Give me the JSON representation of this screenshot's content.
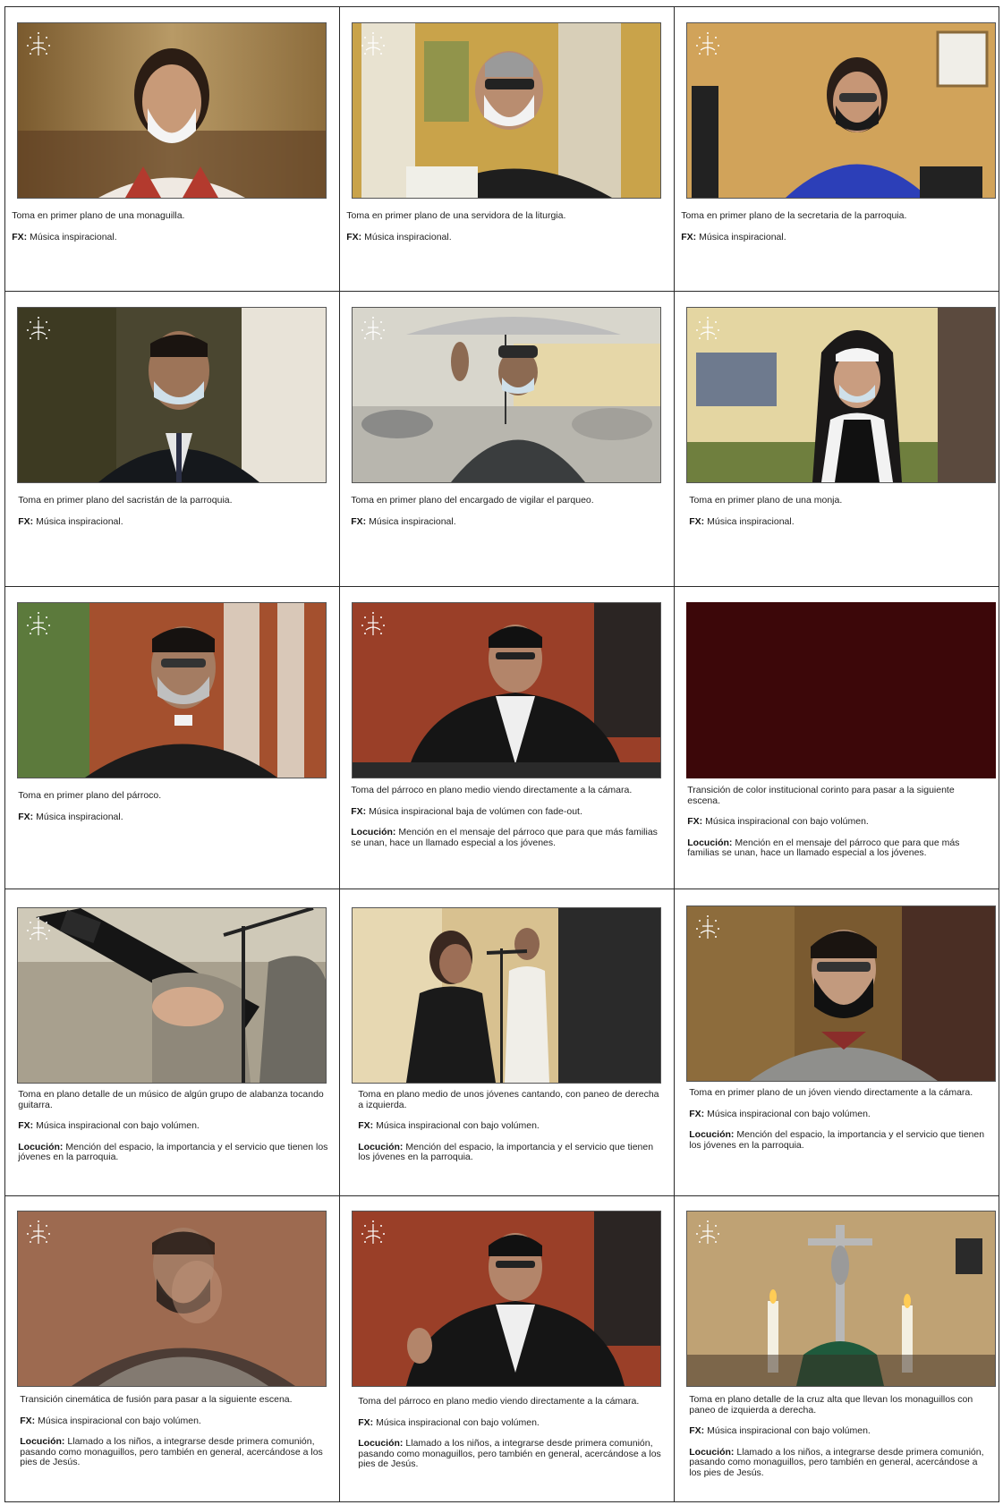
{
  "storyboard": {
    "fx_label": "FX:",
    "locucion_label": "Locución:",
    "panels": [
      {
        "description": "Toma en primer plano de una monaguilla.",
        "fx": "Música inspiracional.",
        "locucion": "",
        "scene": "altar-girl"
      },
      {
        "description": "Toma en primer plano de una servidora de la liturgia.",
        "fx": "Música inspiracional.",
        "locucion": "",
        "scene": "liturgy-server"
      },
      {
        "description": "Toma en primer plano de la secretaria de la parroquia.",
        "fx": "Música inspiracional.",
        "locucion": "",
        "scene": "secretary"
      },
      {
        "description": "Toma en primer plano del sacristán de la parroquia.",
        "fx": "Música inspiracional.",
        "locucion": "",
        "scene": "sacristan"
      },
      {
        "description": "Toma en primer plano del encargado de vigilar el parqueo.",
        "fx": "Música inspiracional.",
        "locucion": "",
        "scene": "parking-guard"
      },
      {
        "description": "Toma en primer plano de una monja.",
        "fx": "Música inspiracional.",
        "locucion": "",
        "scene": "nun"
      },
      {
        "description": "Toma en primer plano del párroco.",
        "fx": "Música inspiracional.",
        "locucion": "",
        "scene": "parish-priest"
      },
      {
        "description": "Toma del párroco en plano medio viendo directamente a la cámara.",
        "fx": "Música inspiracional baja de volúmen con fade-out.",
        "locucion": "Mención en el mensaje del párroco que para que más familias se unan, hace un llamado especial a los jóvenes.",
        "scene": "priest-medium"
      },
      {
        "description": "Transición de color institucional corinto para pasar a la siguiente escena.",
        "fx": "Música inspiracional con bajo volúmen.",
        "locucion": "Mención en el mensaje del párroco que para que más familias se unan, hace un llamado especial a los jóvenes.",
        "scene": "corinto-transition"
      },
      {
        "description": "Toma en plano detalle de un músico de algún grupo de alabanza tocando guitarra.",
        "fx": "Música inspiracional con bajo volúmen.",
        "locucion": "Mención del espacio, la importancia y el servicio que tienen los jóvenes en la parroquia.",
        "scene": "guitar"
      },
      {
        "description": "Toma en plano medio de unos jóvenes cantando, con paneo de derecha a izquierda.",
        "fx": "Música inspiracional con bajo volúmen.",
        "locucion": "Mención del espacio, la importancia y el servicio que tienen los jóvenes en la parroquia.",
        "scene": "singers"
      },
      {
        "description": "Toma en primer plano de un jóven viendo directamente a la cámara.",
        "fx": "Música inspiracional con bajo volúmen.",
        "locucion": "Mención del espacio, la importancia y el servicio que tienen los jóvenes en la parroquia.",
        "scene": "young-man"
      },
      {
        "description": "Transición cinemática de fusión para pasar a la siguiente escena.",
        "fx": "Música inspiracional con bajo volúmen.",
        "locucion": "Llamado a los niños, a integrarse desde primera comunión, pasando como monaguillos, pero también en general, acercándose a los pies de Jesús.",
        "scene": "fusion-transition"
      },
      {
        "description": "Toma del párroco en plano medio viendo directamente a la cámara.",
        "fx": "Música inspiracional con bajo volúmen.",
        "locucion": "Llamado a los niños, a integrarse desde primera comunión, pasando como monaguillos, pero también en general, acercándose a los pies de Jesús.",
        "scene": "priest-medium-2"
      },
      {
        "description": "Toma en plano detalle de la cruz alta que llevan los monaguillos con paneo de izquierda a derecha.",
        "fx": "Música inspiracional con bajo volúmen.",
        "locucion": "Llamado a los niños, a integrarse desde primera comunión, pasando como monaguillos, pero también en general, acercándose a los pies de Jesús.",
        "scene": "processional-cross"
      }
    ]
  }
}
